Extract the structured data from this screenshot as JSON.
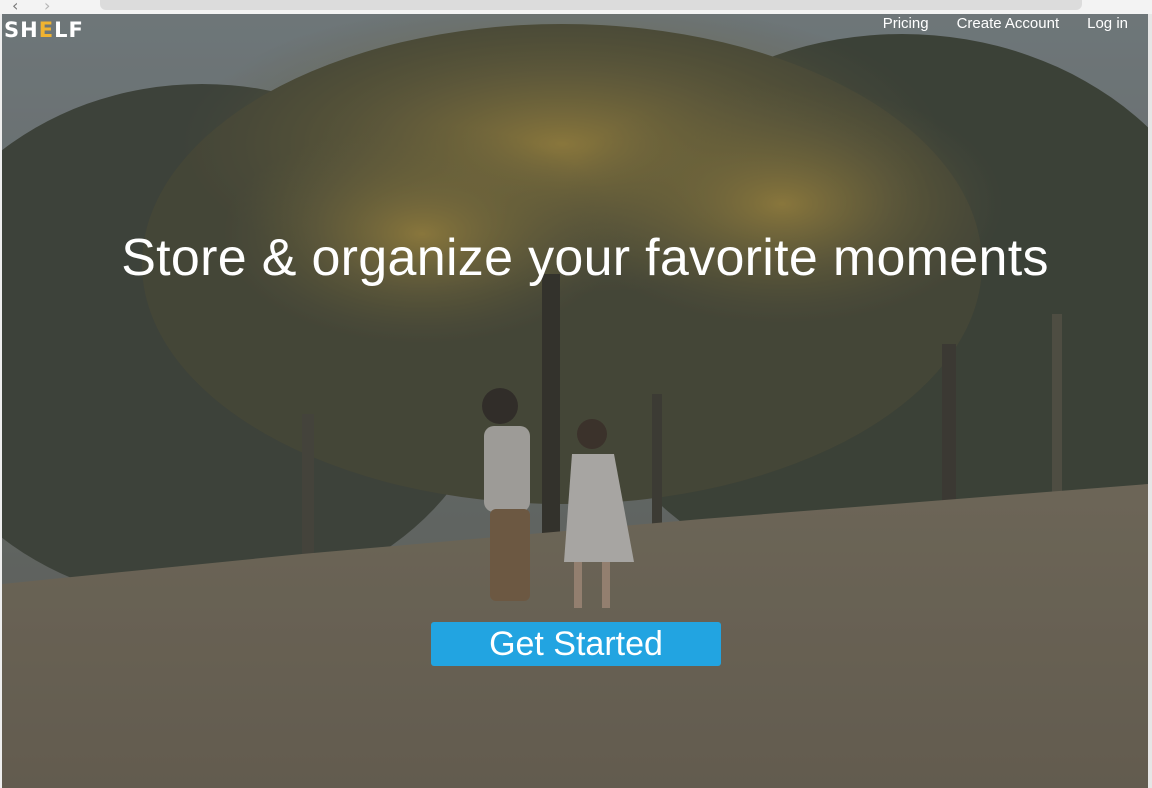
{
  "browser": {
    "back_icon": "chevron-left-icon",
    "forward_icon": "chevron-right-icon"
  },
  "brand": {
    "logo_prefix": "SH",
    "logo_accent": "E",
    "logo_suffix": "LF",
    "accent_color": "#f0b330"
  },
  "nav": {
    "pricing": "Pricing",
    "create_account": "Create Account",
    "login": "Log in"
  },
  "hero": {
    "headline": "Store & organize your favorite moments",
    "cta_label": "Get Started",
    "cta_color": "#22a4e1",
    "background_image": "two children playing in a park under autumn trees"
  }
}
